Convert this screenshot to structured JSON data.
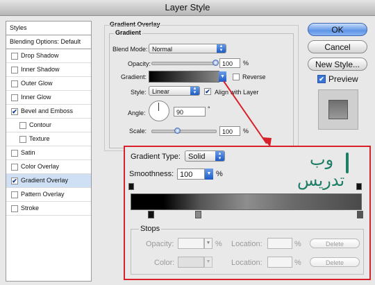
{
  "window": {
    "title": "Layer Style"
  },
  "styles_list": [
    {
      "label": "Styles",
      "checkbox": false,
      "checked": false,
      "header": true
    },
    {
      "label": "Blending Options: Default",
      "checkbox": false,
      "checked": false,
      "header": true
    },
    {
      "label": "Drop Shadow",
      "checkbox": true,
      "checked": false
    },
    {
      "label": "Inner Shadow",
      "checkbox": true,
      "checked": false
    },
    {
      "label": "Outer Glow",
      "checkbox": true,
      "checked": false
    },
    {
      "label": "Inner Glow",
      "checkbox": true,
      "checked": false
    },
    {
      "label": "Bevel and Emboss",
      "checkbox": true,
      "checked": true
    },
    {
      "label": "Contour",
      "checkbox": true,
      "checked": false,
      "indent": true
    },
    {
      "label": "Texture",
      "checkbox": true,
      "checked": false,
      "indent": true
    },
    {
      "label": "Satin",
      "checkbox": true,
      "checked": false
    },
    {
      "label": "Color Overlay",
      "checkbox": true,
      "checked": false
    },
    {
      "label": "Gradient Overlay",
      "checkbox": true,
      "checked": true,
      "selected": true
    },
    {
      "label": "Pattern Overlay",
      "checkbox": true,
      "checked": false
    },
    {
      "label": "Stroke",
      "checkbox": true,
      "checked": false
    }
  ],
  "gradient_overlay": {
    "section_title": "Gradient Overlay",
    "group_title": "Gradient",
    "blend_mode_label": "Blend Mode:",
    "blend_mode_value": "Normal",
    "opacity_label": "Opacity:",
    "opacity_value": "100",
    "opacity_unit": "%",
    "opacity_level": 1.0,
    "gradient_label": "Gradient:",
    "reverse_label": "Reverse",
    "reverse_checked": false,
    "style_label": "Style:",
    "style_value": "Linear",
    "align_label": "Align with Layer",
    "align_checked": true,
    "angle_label": "Angle:",
    "angle_value": "90",
    "angle_unit": "°",
    "scale_label": "Scale:",
    "scale_value": "100",
    "scale_unit": "%",
    "scale_level": 0.4
  },
  "buttons": {
    "ok": "OK",
    "cancel": "Cancel",
    "new_style": "New Style...",
    "preview_label": "Preview",
    "preview_checked": true
  },
  "gradient_editor": {
    "type_label": "Gradient Type:",
    "type_value": "Solid",
    "smoothness_label": "Smoothness:",
    "smoothness_value": "100",
    "smoothness_unit": "%",
    "stops_title": "Stops",
    "opacity_label": "Opacity:",
    "opacity_unit": "%",
    "color_label": "Color:",
    "location_label": "Location:",
    "location_unit": "%",
    "delete_label": "Delete",
    "watermark_top": "وب",
    "watermark_bottom": "تدریس"
  },
  "colors": {
    "annotation_red": "#d8202a",
    "selection_blue": "#cfe0f5",
    "accent_blue": "#2a62c8"
  }
}
